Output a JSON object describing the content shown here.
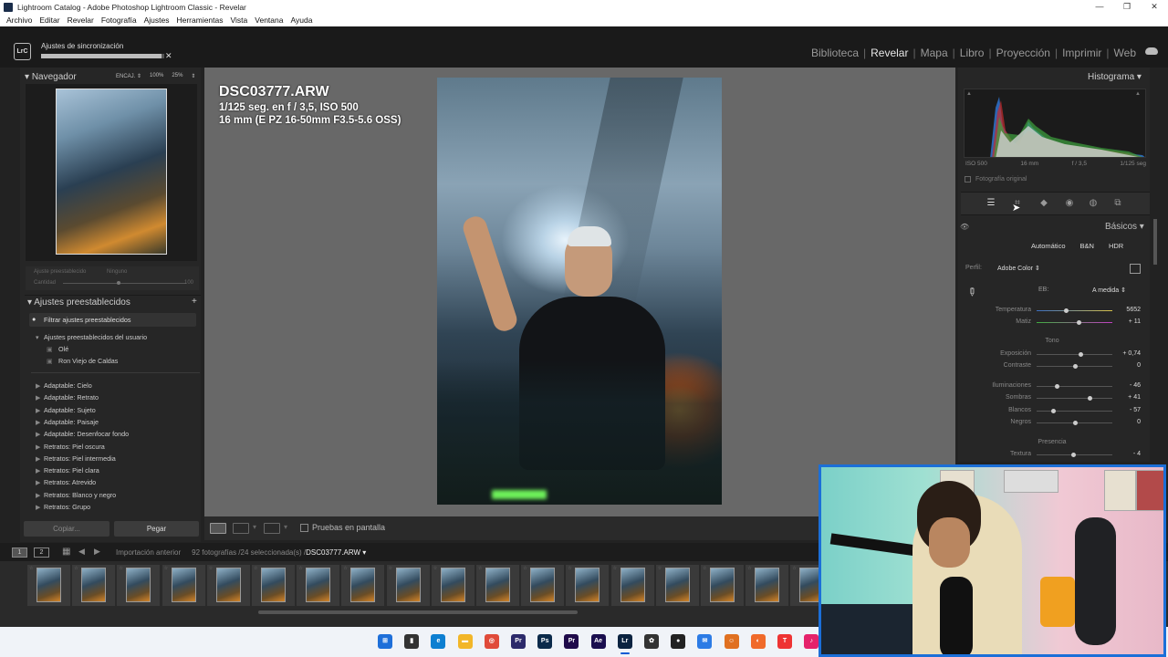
{
  "window": {
    "title": "Lightroom Catalog - Adobe Photoshop Lightroom Classic - Revelar",
    "controls": [
      "—",
      "❐",
      "✕"
    ]
  },
  "menu": [
    "Archivo",
    "Editar",
    "Revelar",
    "Fotografía",
    "Ajustes",
    "Herramientas",
    "Vista",
    "Ventana",
    "Ayuda"
  ],
  "top": {
    "logo": "LrC",
    "sync_label": "Ajustes de sincronización",
    "sync_progress": 0.98,
    "sync_close": "✕",
    "modules": [
      "Biblioteca",
      "Revelar",
      "Mapa",
      "Libro",
      "Proyección",
      "Imprimir",
      "Web"
    ],
    "active_module": "Revelar"
  },
  "left": {
    "navigator_title": "Navegador",
    "navigator_zoom": [
      "ENCAJ. ⇕",
      "100%",
      "25%",
      "⇕"
    ],
    "preset_amount_label": "Ajuste preestablecido",
    "preset_amount_value": "Ninguno",
    "amount_label": "Cantidad",
    "amount_value": "100",
    "presets_title": "Ajustes preestablecidos",
    "presets_add": "+",
    "filter": "Filtrar ajustes preestablecidos",
    "user_group": "Ajustes preestablecidos del usuario",
    "user_items": [
      "Olé",
      "Ron Viejo de Caldas"
    ],
    "groups": [
      "Adaptable: Cielo",
      "Adaptable: Retrato",
      "Adaptable: Sujeto",
      "Adaptable: Paisaje",
      "Adaptable: Desenfocar fondo",
      "Retratos: Piel oscura",
      "Retratos: Piel intermedia",
      "Retratos: Piel clara",
      "Retratos: Atrevido",
      "Retratos: Blanco y negro",
      "Retratos: Grupo"
    ],
    "copy_label": "Copiar...",
    "paste_label": "Pegar"
  },
  "center": {
    "filename": "DSC03777.ARW",
    "exposure_line": "1/125 seg. en f / 3,5, ISO 500",
    "lens_line": "16 mm (E PZ 16-50mm F3.5-5.6 OSS)",
    "proof_label": "Pruebas en pantalla"
  },
  "right": {
    "histogram_title": "Histograma",
    "hist_meta": [
      "ISO 500",
      "16 mm",
      "f / 3,5",
      "1/125 seg"
    ],
    "original_label": "Fotografía original",
    "basics_title": "Básicos",
    "treatments": [
      "Automático",
      "B&N",
      "HDR"
    ],
    "profile_label": "Perfil:",
    "profile_value": "Adobe Color ⇕",
    "wb_label": "EB:",
    "wb_value": "A medida ⇕",
    "tone_section": "Tono",
    "presence_section": "Presencia",
    "sliders_wb": [
      {
        "label": "Temperatura",
        "value": "5652",
        "pos": 0.38
      },
      {
        "label": "Matiz",
        "value": "+ 11",
        "pos": 0.55
      }
    ],
    "sliders_tone": [
      {
        "label": "Exposición",
        "value": "+ 0,74",
        "pos": 0.58
      },
      {
        "label": "Contraste",
        "value": "0",
        "pos": 0.5
      },
      {
        "label": "Iluminaciones",
        "value": "- 46",
        "pos": 0.27
      },
      {
        "label": "Sombras",
        "value": "+ 41",
        "pos": 0.7
      },
      {
        "label": "Blancos",
        "value": "- 57",
        "pos": 0.22
      },
      {
        "label": "Negros",
        "value": "0",
        "pos": 0.5
      }
    ],
    "sliders_presence": [
      {
        "label": "Textura",
        "value": "- 4",
        "pos": 0.48
      }
    ]
  },
  "filmstrip": {
    "view_buttons": [
      "1",
      "2"
    ],
    "source": "Importación anterior",
    "count": "92 fotografías /24 seleccionada(s) /",
    "current": "DSC03777.ARW ▾",
    "thumb_count": 18
  },
  "taskbar_icons": [
    "windows-start",
    "file-explorer-dark",
    "edge",
    "folder",
    "chrome",
    "premiere-rush",
    "photoshop",
    "premiere",
    "after-effects",
    "lightroom",
    "davinci",
    "obs",
    "messenger",
    "firefox",
    "paint",
    "text",
    "tiktok"
  ]
}
